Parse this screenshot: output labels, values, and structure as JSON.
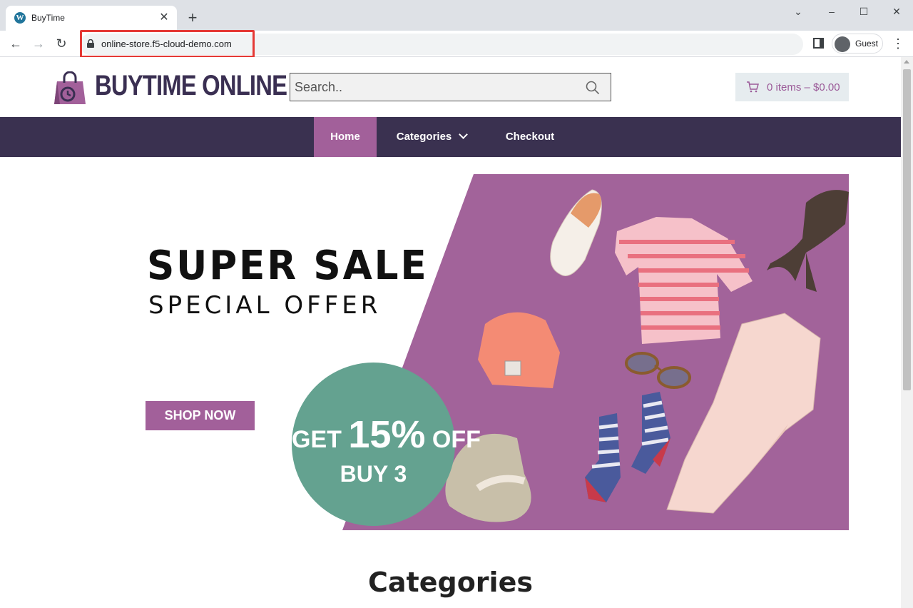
{
  "browser": {
    "tab_title": "BuyTime",
    "url": "online-store.f5-cloud-demo.com",
    "profile_label": "Guest"
  },
  "site": {
    "logo_text": "BUYTIME ONLINE",
    "search_placeholder": "Search..",
    "cart_label": "0 items – $0.00",
    "brand_color": "#a2609a",
    "nav_color": "#3a3150"
  },
  "nav": {
    "home": "Home",
    "categories": "Categories",
    "checkout": "Checkout"
  },
  "banner": {
    "title": "SUPER SALE",
    "subtitle": "SPECIAL OFFER",
    "cta": "SHOP NOW",
    "promo_get": "GET",
    "promo_percent": "15%",
    "promo_off": "OFF",
    "promo_buy": "BUY 3"
  },
  "sections": {
    "categories_heading": "Categories"
  }
}
